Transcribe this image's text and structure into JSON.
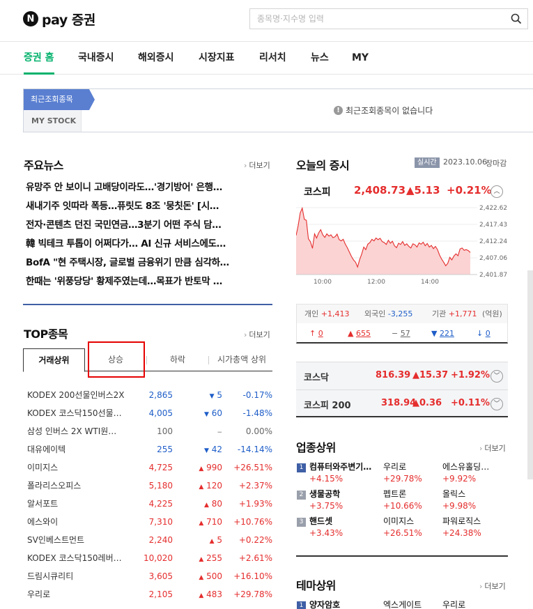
{
  "header": {
    "logo_mark": "N",
    "logo_text": "pay 증권",
    "search_placeholder": "종목명·지수명 입력",
    "search_icon": "search-icon"
  },
  "nav": {
    "items": [
      {
        "label": "증권 홈",
        "active": true
      },
      {
        "label": "국내증시"
      },
      {
        "label": "해외증시"
      },
      {
        "label": "시장지표"
      },
      {
        "label": "리서치"
      },
      {
        "label": "뉴스"
      },
      {
        "label": "MY"
      }
    ]
  },
  "recent": {
    "tab_recent": "최근조회종목",
    "tab_mystock": "MY STOCK",
    "empty_message": "최근조회종목이 없습니다"
  },
  "news": {
    "title": "주요뉴스",
    "more": "더보기",
    "items": [
      "유망주 안 보이니 고배당이라도…'경기방어' 은행…",
      "새내기주 잇따라 폭등…퓨릿도 8조 '뭉칫돈' [시…",
      "전자·콘텐츠 던진 국민연금…3분기 어떤 주식 담…",
      "韓 빅테크 투톱이 어쩌다가… AI 신규 서비스에도…",
      "BofA \"현 주택시장, 글로벌 금융위기 만큼 심각하…",
      "한때는 '위풍당당' 황제주였는데…목표가 반토막 …"
    ]
  },
  "top": {
    "title": "TOP종목",
    "more": "더보기",
    "tabs": [
      "거래상위",
      "상승",
      "하락",
      "시가총액 상위"
    ],
    "rows": [
      {
        "name": "KODEX 200선물인버스2X",
        "price": "2,865",
        "dir": "down",
        "chg": "5",
        "pct": "-0.17%"
      },
      {
        "name": "KODEX 코스닥150선물…",
        "price": "4,005",
        "dir": "down",
        "chg": "60",
        "pct": "-1.48%"
      },
      {
        "name": "삼성 인버스 2X WTI원…",
        "price": "100",
        "dir": "flat",
        "chg": "",
        "pct": "0.00%"
      },
      {
        "name": "대유에이텍",
        "price": "255",
        "dir": "down",
        "chg": "42",
        "pct": "-14.14%"
      },
      {
        "name": "이미지스",
        "price": "4,725",
        "dir": "up",
        "chg": "990",
        "pct": "+26.51%"
      },
      {
        "name": "폴라리스오피스",
        "price": "5,180",
        "dir": "up",
        "chg": "120",
        "pct": "+2.37%"
      },
      {
        "name": "알서포트",
        "price": "4,225",
        "dir": "up",
        "chg": "80",
        "pct": "+1.93%"
      },
      {
        "name": "에스와이",
        "price": "7,310",
        "dir": "up",
        "chg": "710",
        "pct": "+10.76%"
      },
      {
        "name": "SV인베스트먼트",
        "price": "2,240",
        "dir": "up",
        "chg": "5",
        "pct": "+0.22%"
      },
      {
        "name": "KODEX 코스닥150레버…",
        "price": "10,020",
        "dir": "up",
        "chg": "255",
        "pct": "+2.61%"
      },
      {
        "name": "드림시큐리티",
        "price": "3,605",
        "dir": "up",
        "chg": "500",
        "pct": "+16.10%"
      },
      {
        "name": "우리로",
        "price": "2,105",
        "dir": "up",
        "chg": "483",
        "pct": "+29.78%"
      }
    ]
  },
  "market": {
    "title": "오늘의 증시",
    "badge": "실시간",
    "date": "2023.10.06",
    "status": "장마감",
    "kospi": {
      "name": "코스피",
      "value": "2,408.73",
      "chg": "▲5.13",
      "pct": "+0.21%"
    },
    "chart_y_ticks": [
      "2,422.62",
      "2,417.43",
      "2,412.24",
      "2,407.06",
      "2,401.87"
    ],
    "chart_x_ticks": [
      "10:00",
      "12:00",
      "14:00"
    ],
    "investors": [
      {
        "label": "개인",
        "value": "+1,413",
        "dir": "up"
      },
      {
        "label": "외국인",
        "value": "-3,255",
        "dir": "down"
      },
      {
        "label": "기관",
        "value": "+1,771",
        "dir": "up"
      },
      {
        "label": "(억원)",
        "value": "",
        "dir": "flat"
      }
    ],
    "breadth": [
      {
        "symbol": "↑",
        "value": "0",
        "dir": "up"
      },
      {
        "symbol": "▲",
        "value": "655",
        "dir": "up"
      },
      {
        "symbol": "−",
        "value": "57",
        "dir": "flat"
      },
      {
        "symbol": "▼",
        "value": "221",
        "dir": "down"
      },
      {
        "symbol": "↓",
        "value": "0",
        "dir": "down"
      }
    ],
    "kosdaq": {
      "name": "코스닥",
      "value": "816.39",
      "chg": "▲15.37",
      "pct": "+1.92%"
    },
    "kospi200": {
      "name": "코스피 200",
      "value": "318.94",
      "chg": "▲0.36",
      "pct": "+0.11%"
    },
    "colors": {
      "up": "#e52d2d",
      "down": "#1e5dc8",
      "accent": "#03b26c"
    }
  },
  "sector": {
    "title": "업종상위",
    "more": "더보기",
    "rows": [
      {
        "rank": "1",
        "cells": [
          {
            "name": "컴퓨터와주변기…",
            "pct": "+4.15%"
          },
          {
            "name": "우리로",
            "pct": "+29.78%"
          },
          {
            "name": "에스유홀딩…",
            "pct": "+9.92%"
          }
        ]
      },
      {
        "rank": "2",
        "cells": [
          {
            "name": "생물공학",
            "pct": "+3.75%"
          },
          {
            "name": "펩트론",
            "pct": "+10.66%"
          },
          {
            "name": "올릭스",
            "pct": "+9.98%"
          }
        ]
      },
      {
        "rank": "3",
        "cells": [
          {
            "name": "핸드셋",
            "pct": "+3.43%"
          },
          {
            "name": "이미지스",
            "pct": "+26.51%"
          },
          {
            "name": "파워로직스",
            "pct": "+24.38%"
          }
        ]
      }
    ]
  },
  "theme": {
    "title": "테마상위",
    "more": "더보기",
    "rows": [
      {
        "rank": "1",
        "cells": [
          {
            "name": "양자암호"
          },
          {
            "name": "엑스게이트"
          },
          {
            "name": "우리로"
          }
        ]
      }
    ]
  }
}
